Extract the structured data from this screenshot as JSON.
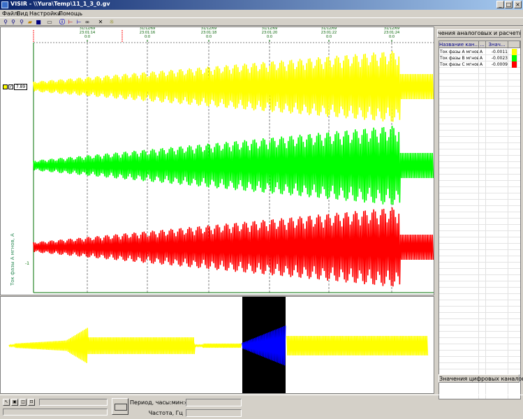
{
  "window": {
    "title": "VISIR - \\\\Yura\\Temp\\11_1_3_0.gv",
    "controls": [
      "minimize",
      "maximize",
      "close"
    ]
  },
  "menu": [
    "Файл",
    "Вид",
    "Настройки",
    "Помощь"
  ],
  "toolbar": [
    "zoom-in-icon",
    "zoom-out-icon",
    "zoom-fit-icon",
    "open-folder-icon",
    "save-icon",
    "print-preview-icon",
    "info-icon",
    "marker-red-icon",
    "marker-blue-icon",
    "binoculars-icon",
    "tools-icon",
    "settings-icon"
  ],
  "plot": {
    "time_labels": [
      {
        "date": "31/12/69",
        "time": "23:01:14",
        "sub": "0:0"
      },
      {
        "date": "31/12/69",
        "time": "23:01:16",
        "sub": "0:0"
      },
      {
        "date": "31/12/69",
        "time": "23:01:18",
        "sub": "0:0"
      },
      {
        "date": "31/12/69",
        "time": "23:01:20",
        "sub": "0:0"
      },
      {
        "date": "31/12/69",
        "time": "23:01:22",
        "sub": "0:0"
      },
      {
        "date": "31/12/69",
        "time": "23:01:24",
        "sub": "0:0"
      }
    ],
    "y_axis_label": "Ток фазы А мгнов, А",
    "scale_value": "7.89",
    "tick_left": "-1",
    "series_colors": {
      "a": "#ffff00",
      "b": "#00ff00",
      "c": "#ff0000"
    }
  },
  "overview": {
    "colors": {
      "trace": "#ffff00",
      "window_bg": "#000000",
      "window_trace": "#0000ff"
    }
  },
  "analog_panel": {
    "title": "чения аналоговых и расчетных кана",
    "columns": [
      "Название кан...",
      "...",
      "Знач..."
    ],
    "rows": [
      {
        "name": "Ток фазы А мгнов",
        "unit": "А",
        "value": "-0.0011",
        "color": "#ffff00"
      },
      {
        "name": "Ток фазы В мгнов",
        "unit": "А",
        "value": "-0.0023",
        "color": "#00ff00"
      },
      {
        "name": "Ток фазы С мгнов",
        "unit": "А",
        "value": "-0.0009",
        "color": "#ff0000"
      }
    ],
    "digital_title": "Значения цифровых каналов"
  },
  "status": {
    "period_label": "Период, часы:мин:сек:мс",
    "freq_label": "Частота, Гц"
  }
}
